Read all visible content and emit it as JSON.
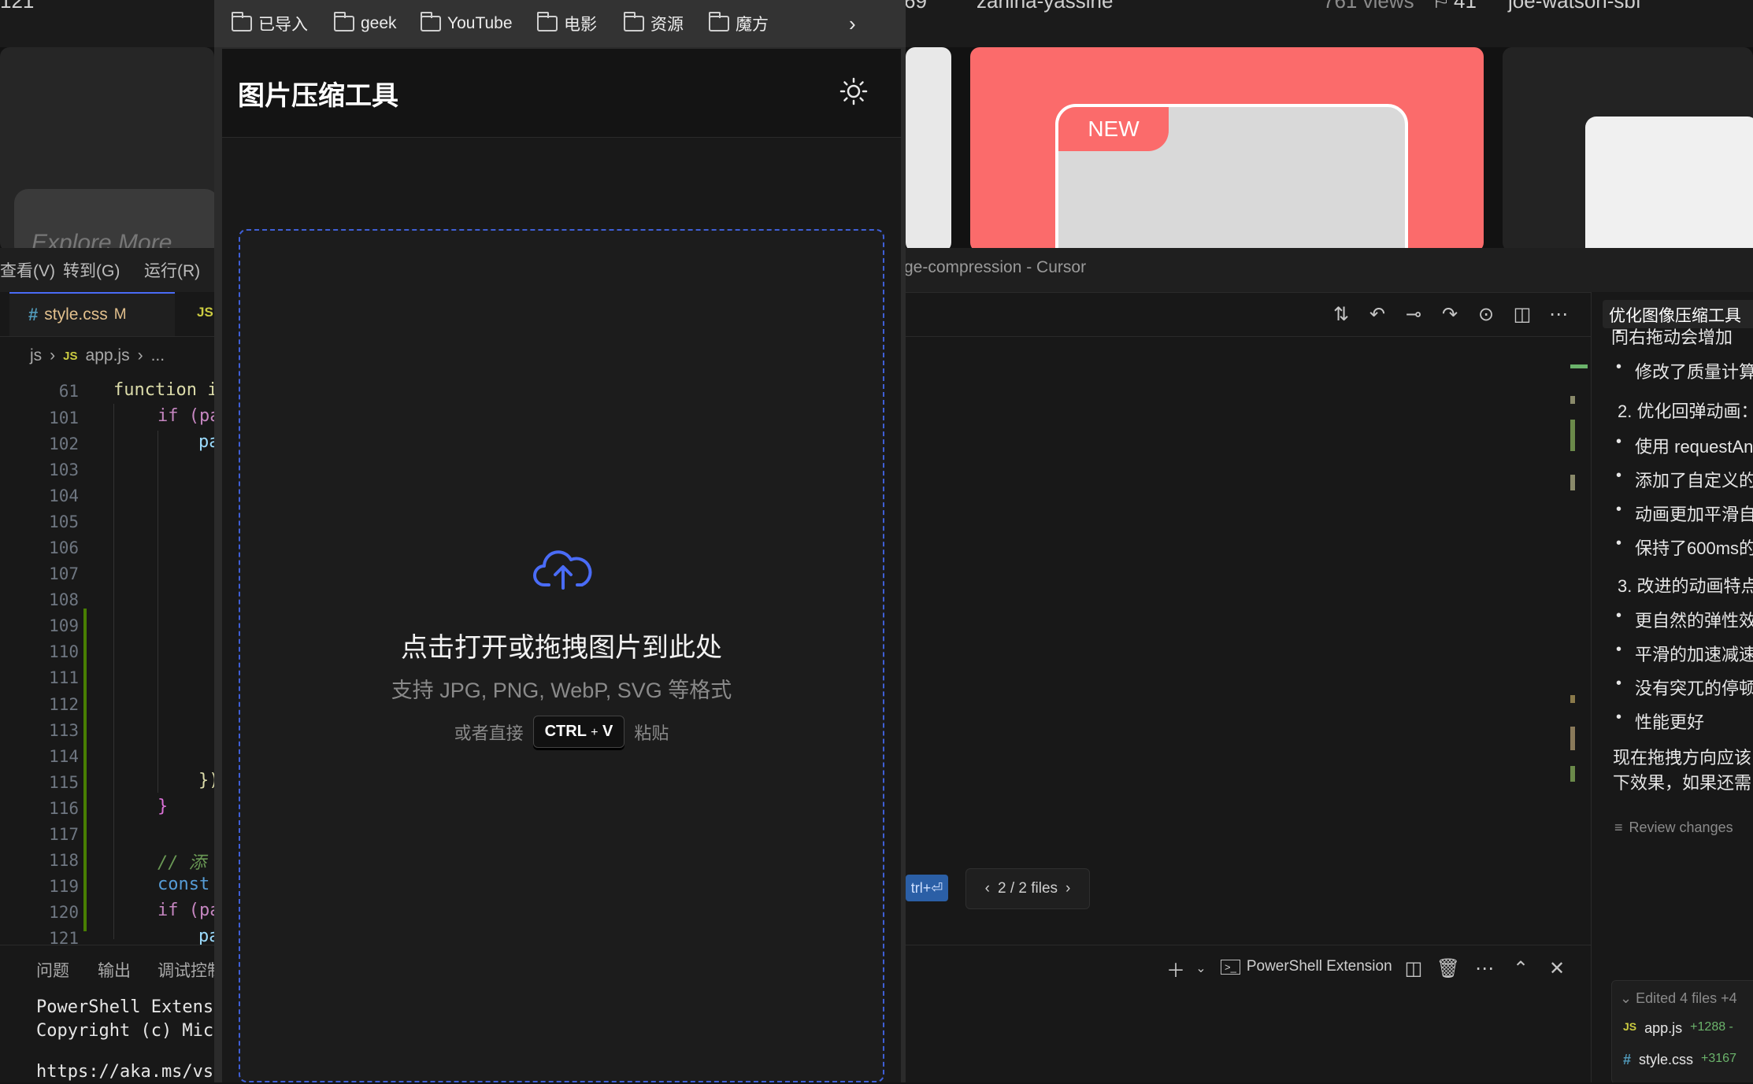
{
  "bg_site": {
    "left_text": "121",
    "stats_a": "69",
    "user_a": "zanina-yassine",
    "views": "761 views",
    "saves": "41",
    "user_b": "joe-watson-sbf",
    "badge": "NEW",
    "explore": "Explore More"
  },
  "editor": {
    "menu": [
      "查看(V)",
      "转到(G)",
      "运行(R)"
    ],
    "window_title": "ge-compression - Cursor",
    "tab_css": "style.css",
    "tab_css_status": "M",
    "tab_js_badge": "JS",
    "breadcrumb_folder": "js",
    "breadcrumb_file": "app.js",
    "breadcrumb_more": "...",
    "lines": [
      "61",
      "101",
      "102",
      "103",
      "104",
      "105",
      "106",
      "107",
      "108",
      "109",
      "110",
      "111",
      "112",
      "113",
      "114",
      "115",
      "116",
      "117",
      "118",
      "119",
      "120",
      "121"
    ],
    "code": {
      "l61": "function i",
      "l101": "if (pa",
      "l102": "pa",
      "l115": "})",
      "l116": "}",
      "l118": "// 添",
      "l119": "const",
      "l120": "if (pa",
      "l121": "pa"
    },
    "panel_tabs": [
      "问题",
      "输出",
      "调试控制"
    ],
    "terminal": [
      "PowerShell Extensi",
      "Copyright (c) Micr",
      "https://aka.ms/vsc"
    ],
    "terminal_name": "PowerShell Extension",
    "files_nav": "2 / 2 files",
    "shortcut_hint": "trl+⏎"
  },
  "chat": {
    "title": "优化图像压缩工具",
    "lines": [
      {
        "kind": "bullet",
        "text": "同右拖动会增加"
      },
      {
        "kind": "bullet",
        "text": "修改了质量计算"
      },
      {
        "kind": "heading",
        "text": "2. 优化回弹动画："
      },
      {
        "kind": "bullet",
        "text": "使用 requestAn"
      },
      {
        "kind": "bullet",
        "text": "添加了自定义的"
      },
      {
        "kind": "bullet",
        "text": "动画更加平滑自"
      },
      {
        "kind": "bullet",
        "text": "保持了600ms的"
      },
      {
        "kind": "heading",
        "text": "3. 改进的动画特点"
      },
      {
        "kind": "bullet",
        "text": "更自然的弹性效"
      },
      {
        "kind": "bullet",
        "text": "平滑的加速减速"
      },
      {
        "kind": "bullet",
        "text": "没有突兀的停顿"
      },
      {
        "kind": "bullet",
        "text": "性能更好"
      }
    ],
    "para1": "现在拖拽方向应该",
    "para2": "下效果，如果还需",
    "review": "Review changes",
    "edited": "Edited 4 files +4",
    "files": [
      {
        "icon": "JS",
        "name": "app.js",
        "diff": "+1288 -"
      },
      {
        "icon": "#",
        "name": "style.css",
        "diff": "+3167"
      }
    ]
  },
  "bookmarks": [
    "已导入",
    "geek",
    "YouTube",
    "电影",
    "资源",
    "魔方"
  ],
  "app": {
    "title": "图片压缩工具",
    "drop_title": "点击打开或拖拽图片到此处",
    "drop_sub": "支持 JPG, PNG, WebP, SVG 等格式",
    "paste_prefix": "或者直接",
    "kbd_ctrl": "CTRL",
    "kbd_plus": "+",
    "kbd_v": "V",
    "paste_suffix": "粘贴"
  },
  "colors": {
    "accent": "#4a6cf7",
    "dropzone_border": "#3f5fd6",
    "card_red": "#fb6b6b"
  }
}
